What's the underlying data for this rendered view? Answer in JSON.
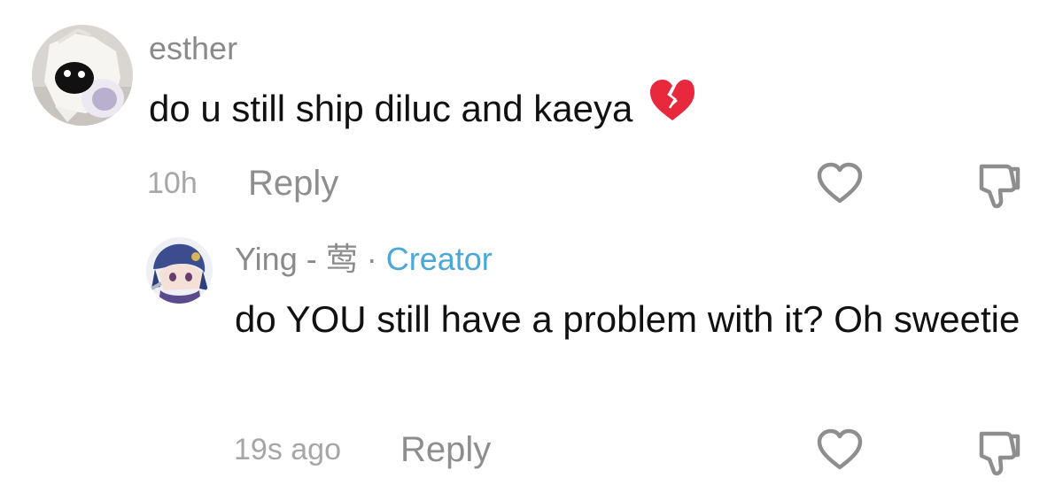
{
  "comment": {
    "username": "esther",
    "text": "do u still ship diluc and kaeya",
    "emoji": "broken-heart-icon",
    "time": "10h",
    "reply_label": "Reply"
  },
  "reply": {
    "username": "Ying - 莺",
    "separator": "·",
    "creator_label": "Creator",
    "text": "do YOU still have a problem with it? Oh sweetie",
    "time": "19s ago",
    "reply_label": "Reply"
  },
  "colors": {
    "creator": "#4aa7d6",
    "username": "#8a8a8a",
    "icon": "#8e8e8e"
  }
}
